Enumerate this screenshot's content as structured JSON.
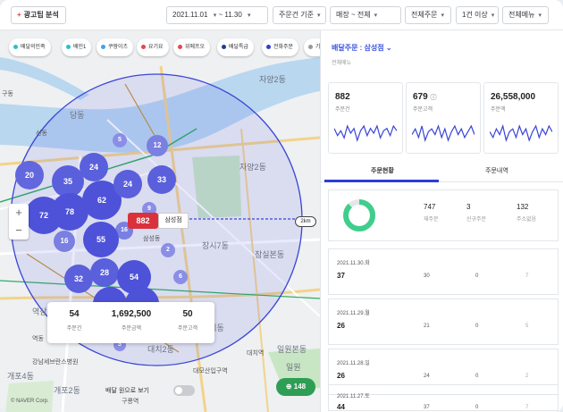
{
  "toolbar": {
    "ad_button": "광고팁 분석",
    "date_start": "2021.11.01",
    "date_end": "11.30",
    "date_sep": "~",
    "basis": "주문건 기준",
    "store": "매장 ~ 전체",
    "order_type": "전체주문",
    "min_count": "1건 이상",
    "menu": "전체메뉴"
  },
  "map": {
    "chips": [
      {
        "label": "배달의민족",
        "color": "#2bc1c8"
      },
      {
        "label": "배민1",
        "color": "#2bc1c8"
      },
      {
        "label": "쿠팡이츠",
        "color": "#3fa1f2"
      },
      {
        "label": "요기요",
        "color": "#e8464b"
      },
      {
        "label": "위메프오",
        "color": "#e8464b"
      },
      {
        "label": "배달특급",
        "color": "#1c3f95"
      },
      {
        "label": "전화주문",
        "color": "#2d3ed8"
      },
      {
        "label": "기",
        "color": "#999999"
      }
    ],
    "places": [
      "자양2동",
      "당동",
      "선동",
      "자양2동",
      "삼성동",
      "장시7동",
      "잠실본동",
      "구동",
      "역삼",
      "대치동",
      "대치2동",
      "대모산입구역",
      "대치역",
      "구룡역",
      "강남세브란스병원",
      "개포4동",
      "개포2동",
      "일원본동",
      "일원",
      "역동"
    ],
    "clusters": [
      "20",
      "35",
      "24",
      "12",
      "33",
      "5",
      "62",
      "24",
      "72",
      "78",
      "9",
      "16",
      "55",
      "16",
      "2",
      "28",
      "32",
      "54",
      "6",
      "3"
    ],
    "store": {
      "count": "882",
      "name": "삼성점",
      "distance": "2km"
    },
    "stats": [
      {
        "value": "54",
        "label": "주문건"
      },
      {
        "value": "1,692,500",
        "label": "주문금액"
      },
      {
        "value": "50",
        "label": "주문고객"
      }
    ],
    "toggle_label": "배달 원으로 보기",
    "green_badge": "148",
    "attribution": "© NAVER Corp."
  },
  "panel": {
    "title": "배달주문 : 삼성점",
    "subtitle": "전체메뉴",
    "kpis": [
      {
        "value": "882",
        "label": "주문건",
        "trend": [
          8,
          5,
          7,
          4,
          9,
          6,
          8,
          3,
          7,
          9,
          5,
          8,
          6,
          9,
          4,
          7,
          8,
          5,
          9,
          7
        ]
      },
      {
        "value": "679",
        "label": "주문고객",
        "trend": [
          6,
          8,
          5,
          9,
          4,
          7,
          8,
          6,
          9,
          5,
          8,
          4,
          7,
          9,
          6,
          8,
          5,
          7,
          9,
          6
        ]
      },
      {
        "value": "26,558,000",
        "label": "주문액",
        "trend": [
          7,
          5,
          8,
          6,
          9,
          4,
          7,
          8,
          5,
          9,
          6,
          8,
          4,
          7,
          9,
          5,
          8,
          6,
          9,
          7
        ]
      }
    ],
    "tabs": [
      "주문현황",
      "주문내역"
    ],
    "summary": {
      "ring_percent": 0.88,
      "items": [
        {
          "value": "747",
          "label": "재주문"
        },
        {
          "value": "3",
          "label": "신규주문"
        },
        {
          "value": "132",
          "label": "주소없음"
        }
      ]
    },
    "days": [
      {
        "date": "2021.11.30.화",
        "count": "37",
        "c1": "30",
        "c2": "0",
        "c3": "7"
      },
      {
        "date": "2021.11.29.월",
        "count": "26",
        "c1": "21",
        "c2": "0",
        "c3": "5"
      },
      {
        "date": "2021.11.28.일",
        "count": "26",
        "c1": "24",
        "c2": "0",
        "c3": "2"
      },
      {
        "date": "2021.11.27.토",
        "count": "44",
        "c1": "37",
        "c2": "0",
        "c3": "7"
      }
    ]
  }
}
